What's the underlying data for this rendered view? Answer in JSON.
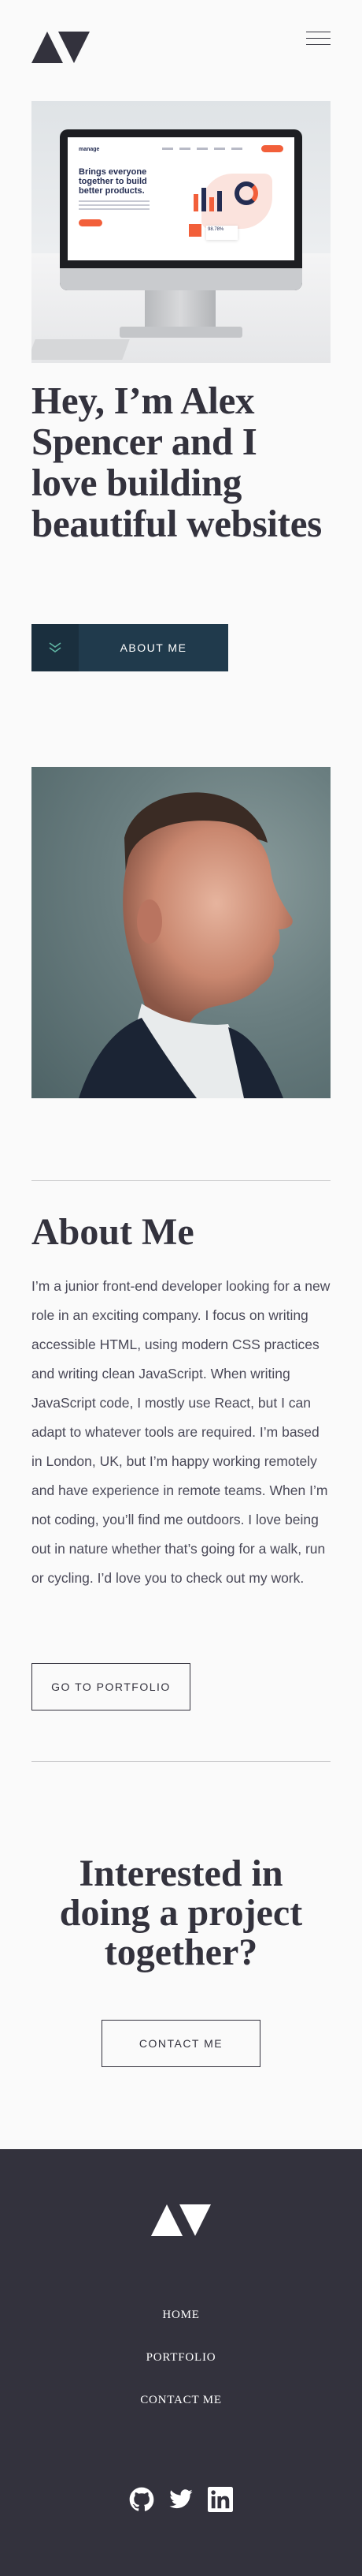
{
  "header": {
    "logo": "logo-av-icon",
    "menu_icon": "hamburger-icon"
  },
  "hero": {
    "image_screen_heading": "Brings everyone together to build better products.",
    "image_screen_logo": "manage",
    "image_stat": "98.78%",
    "title": "Hey, I’m Alex Spencer and I love building beautiful websites",
    "cta_label": "ABOUT ME",
    "cta_icon": "chevrons-down-icon"
  },
  "about": {
    "title": "About Me",
    "text": "I’m a junior front-end developer looking for a new role in an exciting company. I focus on writing accessible HTML, using modern CSS practices and writing clean JavaScript. When writing JavaScript code, I mostly use React, but I can adapt to whatever tools are required. I’m based in London, UK, but I’m happy working remotely and have experience in remote teams. When I’m not coding, you’ll find me outdoors. I love being out in nature whether that’s going for a walk, run or cycling. I’d love you to check out my work.",
    "button_label": "GO TO PORTFOLIO"
  },
  "contact": {
    "title": "Interested in doing a project together?",
    "button_label": "CONTACT ME"
  },
  "footer": {
    "nav": [
      "HOME",
      "PORTFOLIO",
      "CONTACT ME"
    ],
    "social": [
      "github-icon",
      "twitter-icon",
      "linkedin-icon"
    ]
  },
  "colors": {
    "background": "#FAFAFA",
    "text": "#33323D",
    "accent": "#203A4C",
    "footer": "#33323D"
  }
}
